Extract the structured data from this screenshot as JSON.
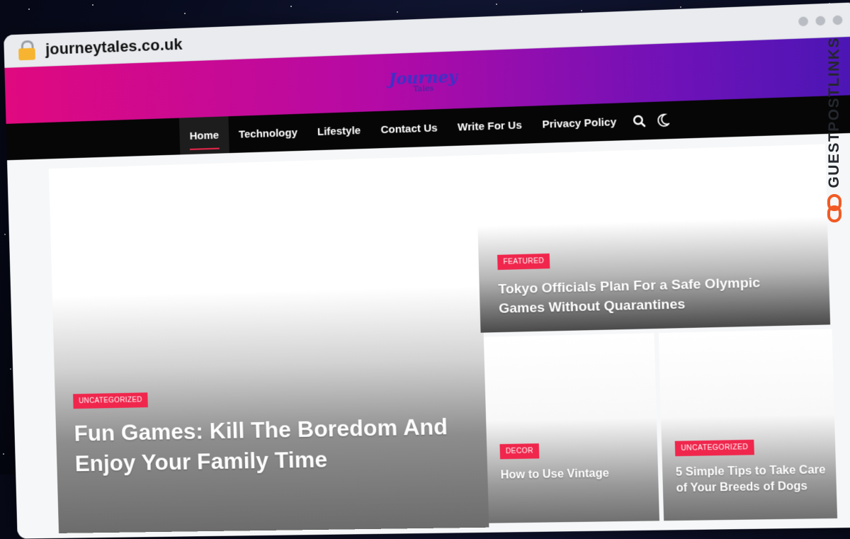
{
  "browser": {
    "url": "journeytales.co.uk",
    "lock_icon": "lock-icon"
  },
  "site": {
    "logo_line1": "Journey",
    "logo_line2": "Tales",
    "colors": {
      "header_gradient_start": "#e0097f",
      "header_gradient_end": "#4a16b4",
      "nav_background": "#060606",
      "accent": "#f0264c"
    }
  },
  "nav": {
    "items": [
      {
        "label": "Home",
        "active": true
      },
      {
        "label": "Technology"
      },
      {
        "label": "Lifestyle"
      },
      {
        "label": "Contact Us"
      },
      {
        "label": "Write For Us"
      },
      {
        "label": "Privacy Policy"
      }
    ],
    "search_icon": "search-icon",
    "dark_mode_icon": "moon-icon"
  },
  "posts": {
    "hero": {
      "category": "UNCATEGORIZED",
      "title": "Fun Games: Kill The Boredom And Enjoy Your Family Time"
    },
    "top_right": {
      "category": "FEATURED",
      "title": "Tokyo Officials Plan For a Safe Olympic Games Without Quarantines"
    },
    "bottom_a": {
      "category": "DECOR",
      "title": "How to Use Vintage"
    },
    "bottom_b": {
      "category": "UNCATEGORIZED",
      "title": "5 Simple Tips to Take Care of Your Breeds of Dogs"
    }
  },
  "watermark": {
    "text": "GUESTPOSTLINKS",
    "icon": "chain-link-icon"
  }
}
